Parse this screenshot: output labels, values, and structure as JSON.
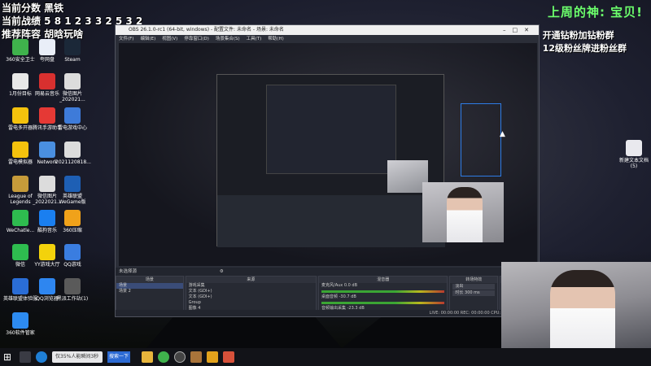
{
  "overlay_left": {
    "line1": "当前分数 黑铁",
    "line2": "当前战绩 5 8 1 2 3 3 2 5 3 2",
    "line3": "推荐阵容 胡晗玩啥"
  },
  "overlay_right": {
    "title": "上周的神: 宝贝!",
    "line1": "开通钻粉加钻粉群",
    "line2": "12级粉丝牌进粉丝群"
  },
  "desktop_icons": [
    {
      "label": "360安全卫士",
      "color": "#3fb24c"
    },
    {
      "label": "夸网盘",
      "color": "#e9eef8"
    },
    {
      "label": "Steam",
      "color": "#1b2838"
    },
    {
      "label": "1月份目标",
      "color": "#e8e8e8"
    },
    {
      "label": "网易云音乐",
      "color": "#d8302f"
    },
    {
      "label": "微信图片_202021...",
      "color": "#dcdcdc"
    },
    {
      "label": "雷电多开器",
      "color": "#f4c20d"
    },
    {
      "label": "腾讯手游助手",
      "color": "#e53935"
    },
    {
      "label": "雷电游戏中心",
      "color": "#3e7bd9"
    },
    {
      "label": "雷电模拟器",
      "color": "#f4c20d"
    },
    {
      "label": "Network",
      "color": "#4a8fe0"
    },
    {
      "label": "2021120818...",
      "color": "#dcdcdc"
    },
    {
      "label": "League of Legends",
      "color": "#c69b3a"
    },
    {
      "label": "微信图片_2022021...",
      "color": "#dcdcdc"
    },
    {
      "label": "英雄联盟WeGame版",
      "color": "#1e5fb4"
    },
    {
      "label": "WeChatle...",
      "color": "#2ebc4f"
    },
    {
      "label": "酷狗音乐",
      "color": "#1a7ff0"
    },
    {
      "label": "360压缩",
      "color": "#f0a21a"
    },
    {
      "label": "微信",
      "color": "#2ebc4f"
    },
    {
      "label": "YY游戏大厅",
      "color": "#f3d20c"
    },
    {
      "label": "QQ游戏",
      "color": "#3a7de0"
    },
    {
      "label": "英雄联盟体验服",
      "color": "#2a6dd6"
    },
    {
      "label": "QQ浏览器",
      "color": "#2e86f0"
    },
    {
      "label": "黑派工作站(1)",
      "color": "#5a5a5a"
    },
    {
      "label": "360软件管家",
      "color": "#2d8bf0"
    }
  ],
  "desktop_right_icon": "新建文本文档(5)",
  "obs": {
    "title": "OBS 26.1.0-rc1 (64-bit, windows) - 配置文件: 未命名 - 场景: 未命名",
    "menus": [
      "文件(F)",
      "编辑(E)",
      "视图(V)",
      "停靠窗口(D)",
      "场景集合(S)",
      "工具(T)",
      "帮助(H)"
    ],
    "scene_bar": "未选择源",
    "docks": {
      "scenes": {
        "title": "场景",
        "items": [
          "场景",
          "场景 2"
        ]
      },
      "sources": {
        "title": "来源",
        "items": [
          "游戏采集",
          "文本 (GDI+)",
          "文本 (GDI+)",
          "Group",
          "图像 4",
          "图像"
        ]
      },
      "mixer": {
        "title": "混音器",
        "channels": [
          "麦克风/Aux",
          "桌面音频",
          "音频输出采集"
        ],
        "levels": [
          "0.0 dB",
          "-30.7 dB",
          "-23.3 dB"
        ]
      },
      "transitions": {
        "title": "转场特效",
        "mode": "淡出",
        "duration_label": "时长",
        "duration": "300 ms"
      },
      "controls": {
        "title": "控件",
        "items": [
          "开始推流",
          "开始录制",
          "启动虚拟摄像机",
          "工作室模式",
          "设置",
          "退出"
        ]
      }
    },
    "status": "LIVE: 00:00:00  REC: 00:00:00  CPU: 5.9%, 30.00 fps"
  },
  "taskbar": {
    "search_placeholder": "仅35%人能瞬间3秒",
    "search_button": "搜索一下"
  }
}
